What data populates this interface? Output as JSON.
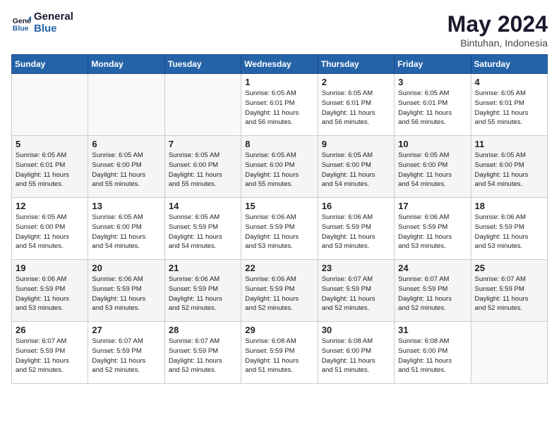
{
  "logo": {
    "line1": "General",
    "line2": "Blue"
  },
  "title": "May 2024",
  "subtitle": "Bintuhan, Indonesia",
  "weekdays": [
    "Sunday",
    "Monday",
    "Tuesday",
    "Wednesday",
    "Thursday",
    "Friday",
    "Saturday"
  ],
  "weeks": [
    [
      {
        "day": "",
        "info": ""
      },
      {
        "day": "",
        "info": ""
      },
      {
        "day": "",
        "info": ""
      },
      {
        "day": "1",
        "info": "Sunrise: 6:05 AM\nSunset: 6:01 PM\nDaylight: 11 hours\nand 56 minutes."
      },
      {
        "day": "2",
        "info": "Sunrise: 6:05 AM\nSunset: 6:01 PM\nDaylight: 11 hours\nand 56 minutes."
      },
      {
        "day": "3",
        "info": "Sunrise: 6:05 AM\nSunset: 6:01 PM\nDaylight: 11 hours\nand 56 minutes."
      },
      {
        "day": "4",
        "info": "Sunrise: 6:05 AM\nSunset: 6:01 PM\nDaylight: 11 hours\nand 55 minutes."
      }
    ],
    [
      {
        "day": "5",
        "info": "Sunrise: 6:05 AM\nSunset: 6:01 PM\nDaylight: 11 hours\nand 55 minutes."
      },
      {
        "day": "6",
        "info": "Sunrise: 6:05 AM\nSunset: 6:00 PM\nDaylight: 11 hours\nand 55 minutes."
      },
      {
        "day": "7",
        "info": "Sunrise: 6:05 AM\nSunset: 6:00 PM\nDaylight: 11 hours\nand 55 minutes."
      },
      {
        "day": "8",
        "info": "Sunrise: 6:05 AM\nSunset: 6:00 PM\nDaylight: 11 hours\nand 55 minutes."
      },
      {
        "day": "9",
        "info": "Sunrise: 6:05 AM\nSunset: 6:00 PM\nDaylight: 11 hours\nand 54 minutes."
      },
      {
        "day": "10",
        "info": "Sunrise: 6:05 AM\nSunset: 6:00 PM\nDaylight: 11 hours\nand 54 minutes."
      },
      {
        "day": "11",
        "info": "Sunrise: 6:05 AM\nSunset: 6:00 PM\nDaylight: 11 hours\nand 54 minutes."
      }
    ],
    [
      {
        "day": "12",
        "info": "Sunrise: 6:05 AM\nSunset: 6:00 PM\nDaylight: 11 hours\nand 54 minutes."
      },
      {
        "day": "13",
        "info": "Sunrise: 6:05 AM\nSunset: 6:00 PM\nDaylight: 11 hours\nand 54 minutes."
      },
      {
        "day": "14",
        "info": "Sunrise: 6:05 AM\nSunset: 5:59 PM\nDaylight: 11 hours\nand 54 minutes."
      },
      {
        "day": "15",
        "info": "Sunrise: 6:06 AM\nSunset: 5:59 PM\nDaylight: 11 hours\nand 53 minutes."
      },
      {
        "day": "16",
        "info": "Sunrise: 6:06 AM\nSunset: 5:59 PM\nDaylight: 11 hours\nand 53 minutes."
      },
      {
        "day": "17",
        "info": "Sunrise: 6:06 AM\nSunset: 5:59 PM\nDaylight: 11 hours\nand 53 minutes."
      },
      {
        "day": "18",
        "info": "Sunrise: 6:06 AM\nSunset: 5:59 PM\nDaylight: 11 hours\nand 53 minutes."
      }
    ],
    [
      {
        "day": "19",
        "info": "Sunrise: 6:06 AM\nSunset: 5:59 PM\nDaylight: 11 hours\nand 53 minutes."
      },
      {
        "day": "20",
        "info": "Sunrise: 6:06 AM\nSunset: 5:59 PM\nDaylight: 11 hours\nand 53 minutes."
      },
      {
        "day": "21",
        "info": "Sunrise: 6:06 AM\nSunset: 5:59 PM\nDaylight: 11 hours\nand 52 minutes."
      },
      {
        "day": "22",
        "info": "Sunrise: 6:06 AM\nSunset: 5:59 PM\nDaylight: 11 hours\nand 52 minutes."
      },
      {
        "day": "23",
        "info": "Sunrise: 6:07 AM\nSunset: 5:59 PM\nDaylight: 11 hours\nand 52 minutes."
      },
      {
        "day": "24",
        "info": "Sunrise: 6:07 AM\nSunset: 5:59 PM\nDaylight: 11 hours\nand 52 minutes."
      },
      {
        "day": "25",
        "info": "Sunrise: 6:07 AM\nSunset: 5:59 PM\nDaylight: 11 hours\nand 52 minutes."
      }
    ],
    [
      {
        "day": "26",
        "info": "Sunrise: 6:07 AM\nSunset: 5:59 PM\nDaylight: 11 hours\nand 52 minutes."
      },
      {
        "day": "27",
        "info": "Sunrise: 6:07 AM\nSunset: 5:59 PM\nDaylight: 11 hours\nand 52 minutes."
      },
      {
        "day": "28",
        "info": "Sunrise: 6:07 AM\nSunset: 5:59 PM\nDaylight: 11 hours\nand 52 minutes."
      },
      {
        "day": "29",
        "info": "Sunrise: 6:08 AM\nSunset: 5:59 PM\nDaylight: 11 hours\nand 51 minutes."
      },
      {
        "day": "30",
        "info": "Sunrise: 6:08 AM\nSunset: 6:00 PM\nDaylight: 11 hours\nand 51 minutes."
      },
      {
        "day": "31",
        "info": "Sunrise: 6:08 AM\nSunset: 6:00 PM\nDaylight: 11 hours\nand 51 minutes."
      },
      {
        "day": "",
        "info": ""
      }
    ]
  ]
}
